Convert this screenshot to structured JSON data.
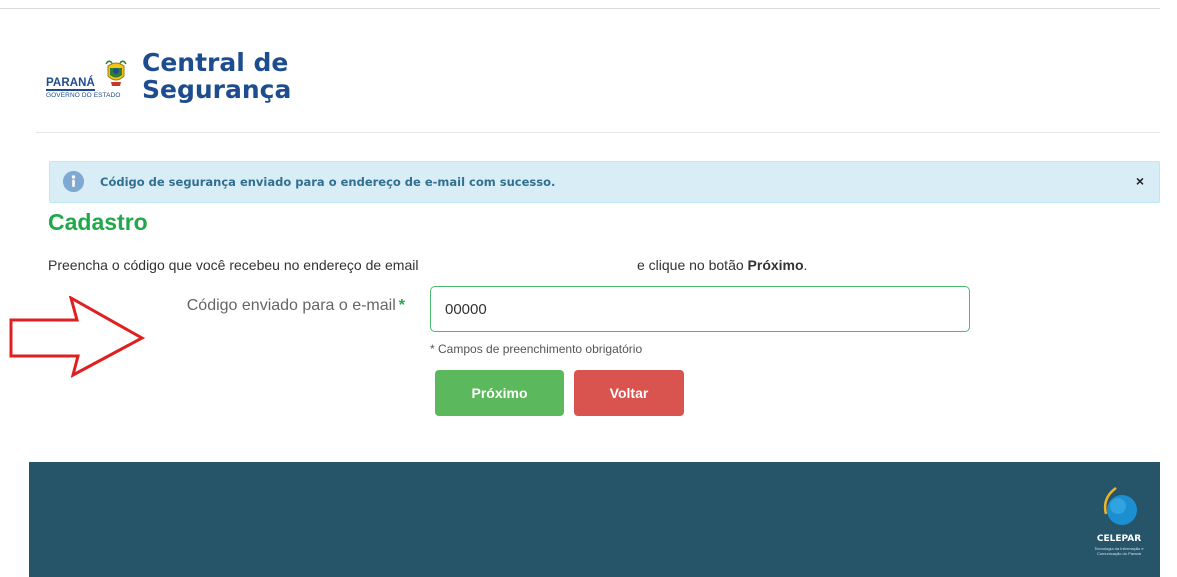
{
  "header": {
    "parana_word": "PARANÁ",
    "parana_sub": "GOVERNO DO ESTADO",
    "title_line1": "Central de",
    "title_line2": "Segurança"
  },
  "alert": {
    "message": "Código de segurança enviado para o endereço de e-mail com sucesso.",
    "close": "×"
  },
  "page": {
    "heading": "Cadastro",
    "instruction_start": "Preencha o código que você recebeu no endereço de email",
    "instruction_end_prefix": "e clique no botão",
    "instruction_end_bold": "Próximo",
    "instruction_end_suffix": "."
  },
  "form": {
    "code_label": "Código enviado para o e-mail",
    "required_mark": "*",
    "code_value": "00000",
    "required_note": "* Campos de preenchimento obrigatório"
  },
  "buttons": {
    "next": "Próximo",
    "back": "Voltar"
  },
  "footer": {
    "brand": "CELEPAR",
    "tagline": "Tecnologia da Informação e Comunicação do Paraná"
  },
  "colors": {
    "brand_blue": "#1d4c8f",
    "heading_green": "#20a84a",
    "next_green": "#5cb85c",
    "back_red": "#d9534f",
    "footer_bg": "#265469",
    "alert_bg": "#d9edf7",
    "arrow_red": "#e02020"
  },
  "icons": [
    "parana-crest-icon",
    "info-icon",
    "close-icon",
    "red-arrow-icon",
    "celepar-logo-icon"
  ]
}
